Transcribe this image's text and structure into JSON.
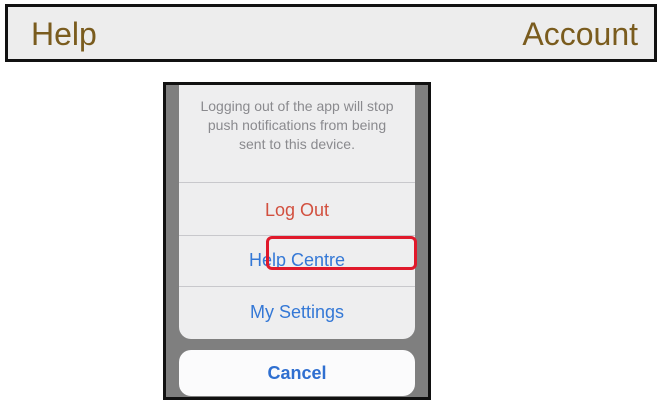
{
  "topbar": {
    "left_label": "Help",
    "right_label": "Account"
  },
  "action_sheet": {
    "message": "Logging out of the app will stop push notifications from being sent to this device.",
    "actions": [
      {
        "label": "Log Out",
        "color": "#d2503f"
      },
      {
        "label": "Help Centre",
        "color": "#3478d6",
        "highlighted": true
      },
      {
        "label": "My Settings",
        "color": "#3478d6"
      }
    ],
    "cancel_label": "Cancel"
  },
  "colors": {
    "topbar_text": "#7a5c1e",
    "highlight_border": "#e0192b",
    "destructive": "#d2503f",
    "action_blue": "#3478d6"
  }
}
